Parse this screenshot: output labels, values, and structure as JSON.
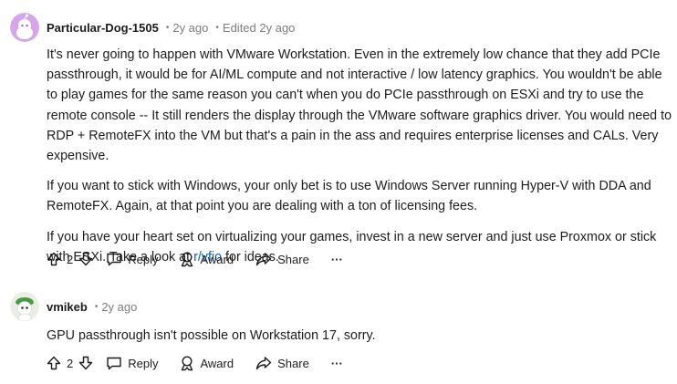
{
  "comments": [
    {
      "author": "Particular-Dog-1505",
      "age": "2y ago",
      "edited": "Edited 2y ago",
      "paragraphs": [
        "It's never going to happen with VMware Workstation. Even in the extremely low chance that they add PCIe passthrough, it would be for AI/ML compute and not interactive / low latency graphics. You wouldn't be able to play games for the same reason you can't when you do PCIe passthrough on ESXi and try to use the remote console -- It still renders the display through the VMware software graphics driver. You would need to RDP + RemoteFX into the VM but that's a pain in the ass and requires enterprise licenses and CALs. Very expensive.",
        "If you want to stick with Windows, your only bet is to use Windows Server running Hyper-V with DDA and RemoteFX. Again, at that point you are dealing with a ton of licensing fees."
      ],
      "last_paragraph_before": "If you have your heart set on virtualizing your games, invest in a new server and just use Proxmox or stick with ESXi. Take a look at ",
      "last_paragraph_link": "r/vfio",
      "last_paragraph_after": " for ideas.",
      "votes": "2"
    },
    {
      "author": "vmikeb",
      "age": "2y ago",
      "paragraphs": [
        "GPU passthrough isn't possible on Workstation 17, sorry."
      ],
      "votes": "2"
    }
  ],
  "actions": {
    "reply": "Reply",
    "award": "Award",
    "share": "Share",
    "more": "···"
  },
  "icons": {
    "upvote": "upvote-icon",
    "downvote": "downvote-icon",
    "reply": "reply-icon",
    "award": "award-icon",
    "share": "share-icon"
  },
  "colors": {
    "link": "#0a5cc2",
    "muted": "#7c7c7c",
    "avatar1_bg": "#d6a6e8",
    "avatar2_bg": "#e8f0e6"
  }
}
